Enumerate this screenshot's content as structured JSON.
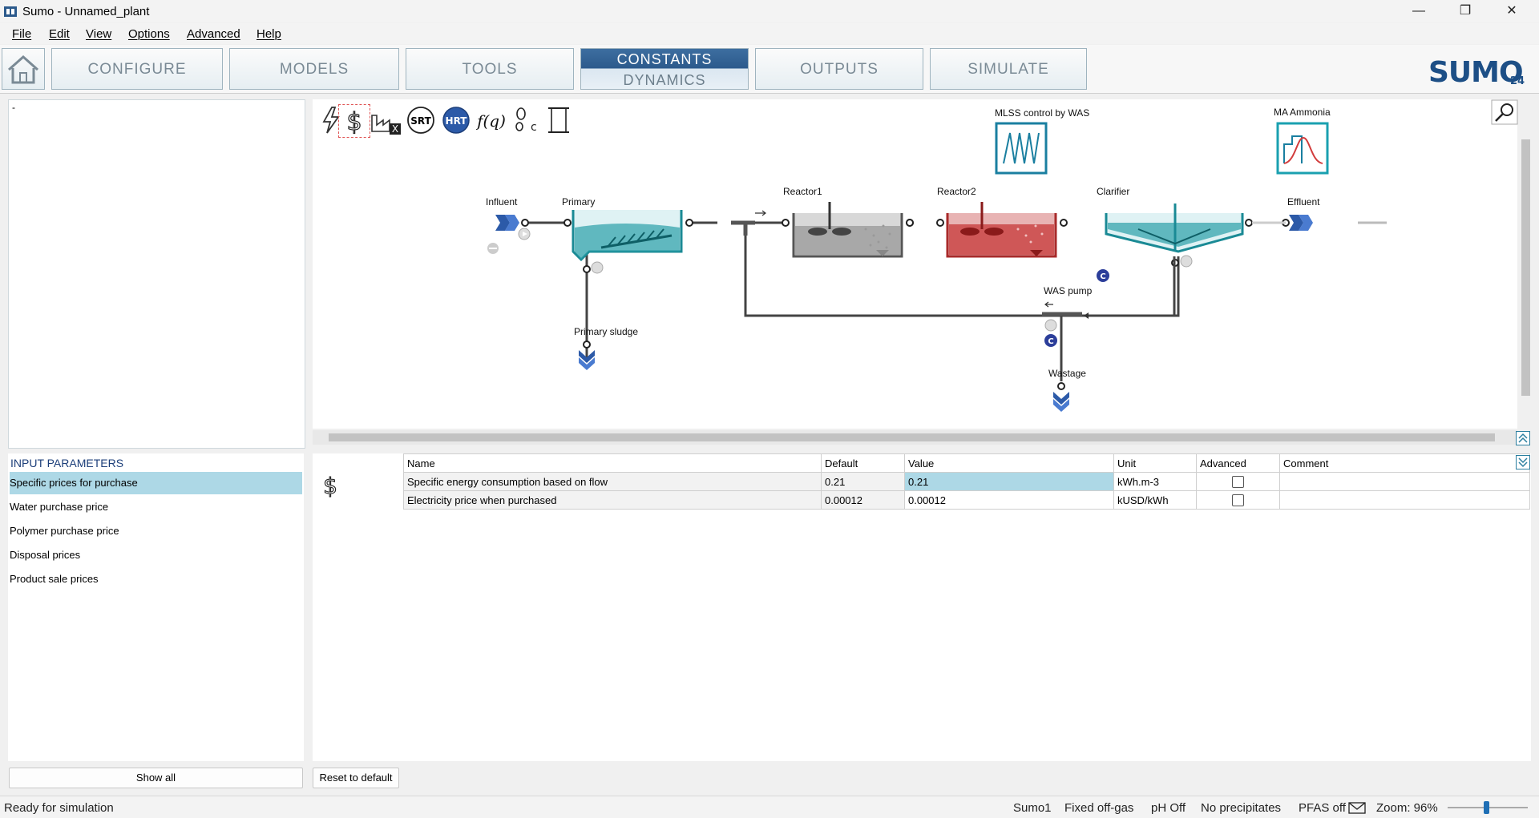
{
  "window": {
    "title": "Sumo - Unnamed_plant"
  },
  "menu": {
    "file": "File",
    "edit": "Edit",
    "view": "View",
    "options": "Options",
    "advanced": "Advanced",
    "help": "Help"
  },
  "tabs": {
    "configure": "CONFIGURE",
    "models": "MODELS",
    "tools": "TOOLS",
    "constants": "CONSTANTS",
    "dynamics": "DYNAMICS",
    "outputs": "OUTPUTS",
    "simulate": "SIMULATE"
  },
  "logo": {
    "text": "SUMO",
    "superscript": "24"
  },
  "left_top": {
    "text": "-"
  },
  "canvas": {
    "labels": {
      "mlss": "MLSS control by WAS",
      "ma_ammonia": "MA Ammonia",
      "influent": "Influent",
      "primary": "Primary",
      "reactor1": "Reactor1",
      "reactor2": "Reactor2",
      "clarifier": "Clarifier",
      "effluent": "Effluent",
      "was_pump": "WAS pump",
      "primary_sludge": "Primary sludge",
      "wastage": "Wastage"
    },
    "controller_badge": "C",
    "toolbar_labels": {
      "srt": "SRT",
      "hrt": "HRT",
      "fq": "f(q)"
    }
  },
  "input_params": {
    "heading": "INPUT PARAMETERS",
    "items": [
      "Specific prices for purchase",
      "Water purchase price",
      "Polymer purchase price",
      "Disposal prices",
      "Product sale prices"
    ],
    "show_all": "Show all",
    "reset": "Reset to default"
  },
  "table": {
    "headers": {
      "name": "Name",
      "default": "Default",
      "value": "Value",
      "unit": "Unit",
      "advanced": "Advanced",
      "comment": "Comment"
    },
    "rows": [
      {
        "name": "Specific energy consumption based on flow",
        "default": "0.21",
        "value": "0.21",
        "unit": "kWh.m-3",
        "advanced": false,
        "comment": ""
      },
      {
        "name": "Electricity price when purchased",
        "default": "0.00012",
        "value": "0.00012",
        "unit": "kUSD/kWh",
        "advanced": false,
        "comment": ""
      }
    ]
  },
  "status": {
    "left": "Ready for simulation",
    "model": "Sumo1",
    "offgas": "Fixed off-gas",
    "ph": "pH Off",
    "precip": "No precipitates",
    "pfas": "PFAS off",
    "zoom": "Zoom: 96%",
    "zoom_value": 0.96
  },
  "colors": {
    "accent": "#2c5a8c",
    "teal": "#1a8a95",
    "reactor2": "#b3242b",
    "selection": "#add8e6"
  }
}
